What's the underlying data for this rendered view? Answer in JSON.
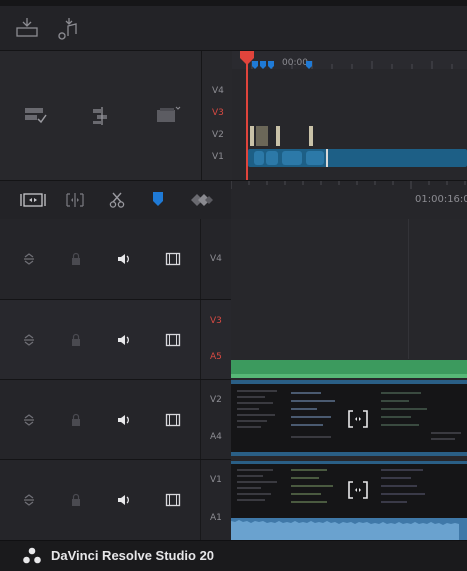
{
  "toolbar_top": {
    "icons": [
      "insert-clip-icon",
      "audio-clip-icon"
    ]
  },
  "mini_timeline": {
    "timecode": "00:00",
    "track_labels": [
      "V4",
      "V3",
      "V2",
      "V1"
    ]
  },
  "timeline_toolbar": {
    "icons": [
      "trim-mode-icon",
      "dynamic-trim-icon",
      "razor-icon",
      "marker-icon",
      "snap-icon"
    ]
  },
  "ruler": {
    "timecode": "01:00:16:0"
  },
  "tracks": [
    {
      "id": "V4",
      "labels": [
        "V4"
      ],
      "red": [
        false
      ]
    },
    {
      "id": "V3A5",
      "labels": [
        "V3",
        "A5"
      ],
      "red": [
        true,
        true
      ]
    },
    {
      "id": "V2A4",
      "labels": [
        "V2",
        "A4"
      ],
      "red": [
        false,
        false
      ]
    },
    {
      "id": "V1A1",
      "labels": [
        "V1",
        "A1"
      ],
      "red": [
        false,
        false
      ]
    }
  ],
  "footer": {
    "app_name": "DaVinci Resolve Studio 20"
  },
  "colors": {
    "accent_red": "#e0443c",
    "clip_blue": "#1d5f86",
    "audio_green": "#3c9a5e",
    "marker_blue": "#1f7ad6"
  }
}
